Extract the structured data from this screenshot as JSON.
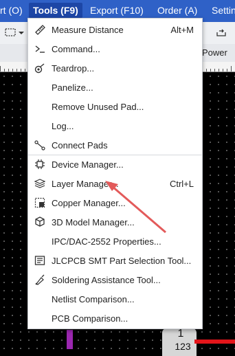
{
  "menubar": {
    "items": [
      {
        "label": "rt (O)"
      },
      {
        "label": "Tools (F9)"
      },
      {
        "label": "Export (F10)"
      },
      {
        "label": "Order (A)"
      },
      {
        "label": "Settin"
      }
    ]
  },
  "tabrow": {
    "tab_label": "Power"
  },
  "tools_menu": {
    "items": [
      {
        "label": "Measure Distance",
        "shortcut": "Alt+M",
        "icon": "ruler-icon"
      },
      {
        "label": "Command...",
        "shortcut": "",
        "icon": "terminal-icon"
      },
      {
        "label": "Teardrop...",
        "shortcut": "",
        "icon": "teardrop-icon"
      },
      {
        "label": "Panelize...",
        "shortcut": "",
        "icon": ""
      },
      {
        "label": "Remove Unused Pad...",
        "shortcut": "",
        "icon": ""
      },
      {
        "label": "Log...",
        "shortcut": "",
        "icon": ""
      },
      {
        "label": "Connect Pads",
        "shortcut": "",
        "icon": "connect-pads-icon"
      },
      {
        "label": "Device Manager...",
        "shortcut": "",
        "icon": "device-manager-icon"
      },
      {
        "label": "Layer Manager...",
        "shortcut": "Ctrl+L",
        "icon": "layer-manager-icon"
      },
      {
        "label": "Copper Manager...",
        "shortcut": "",
        "icon": "copper-manager-icon"
      },
      {
        "label": "3D Model Manager...",
        "shortcut": "",
        "icon": "cube-icon"
      },
      {
        "label": "IPC/DAC-2552 Properties...",
        "shortcut": "",
        "icon": ""
      },
      {
        "label": "JLCPCB SMT Part Selection Tool...",
        "shortcut": "",
        "icon": "smt-part-icon"
      },
      {
        "label": "Soldering Assistance Tool...",
        "shortcut": "",
        "icon": "soldering-icon"
      },
      {
        "label": "Netlist Comparison...",
        "shortcut": "",
        "icon": ""
      },
      {
        "label": "PCB Comparison...",
        "shortcut": "",
        "icon": ""
      }
    ]
  },
  "canvas": {
    "pad_number": "1",
    "pad_sub": "123"
  },
  "colors": {
    "menubar": "#2f61c7",
    "menubar_active": "#1d46a6",
    "annotation_arrow": "#e35a5a"
  }
}
